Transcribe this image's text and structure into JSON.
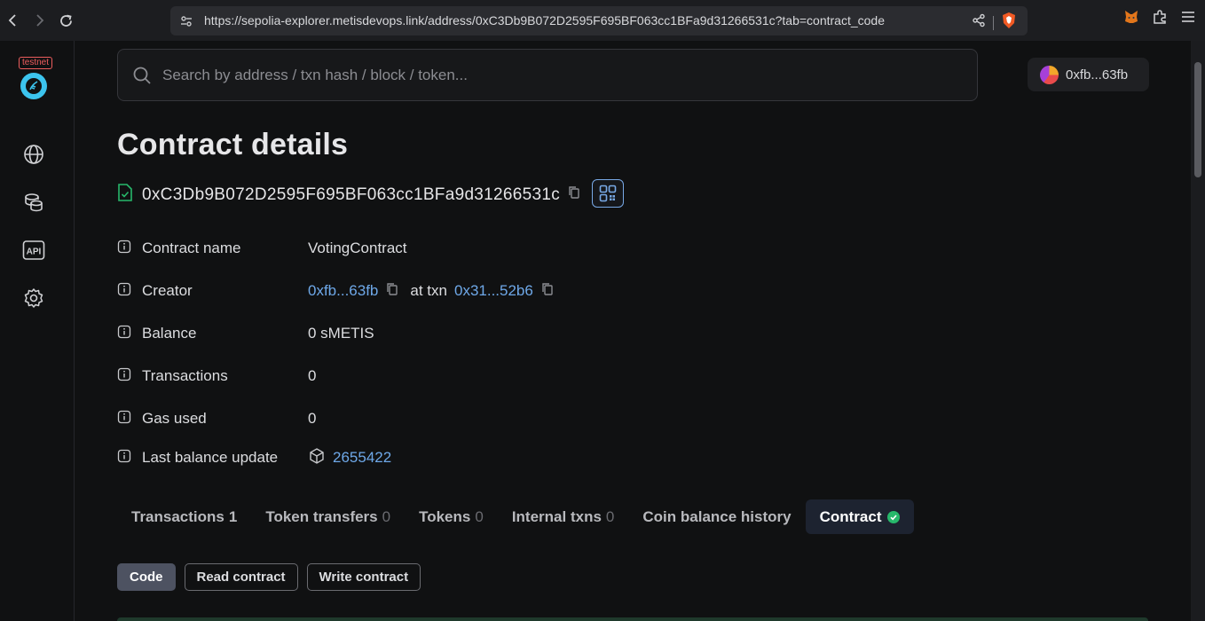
{
  "browser": {
    "url": "https://sepolia-explorer.metisdevops.link/address/0xC3Db9B072D2595F695BF063cc1BFa9d31266531c?tab=contract_code"
  },
  "sidebar": {
    "badge": "testnet",
    "items": [
      {
        "icon": "globe-icon"
      },
      {
        "icon": "coins-icon"
      },
      {
        "icon": "api-icon",
        "label": "API"
      },
      {
        "icon": "gear-icon"
      }
    ]
  },
  "search": {
    "placeholder": "Search by address / txn hash / block / token..."
  },
  "account": {
    "label": "0xfb...63fb"
  },
  "page": {
    "title": "Contract details",
    "address": "0xC3Db9B072D2595F695BF063cc1BFa9d31266531c"
  },
  "details": {
    "contract_name_label": "Contract name",
    "contract_name": "VotingContract",
    "creator_label": "Creator",
    "creator": "0xfb...63fb",
    "at_txn": "at txn",
    "creator_txn": "0x31...52b6",
    "balance_label": "Balance",
    "balance": "0 sMETIS",
    "transactions_label": "Transactions",
    "transactions": "0",
    "gas_label": "Gas used",
    "gas": "0",
    "last_update_label": "Last balance update",
    "last_update": "2655422"
  },
  "tabs": [
    {
      "label": "Transactions",
      "count": "1"
    },
    {
      "label": "Token transfers",
      "count": "0"
    },
    {
      "label": "Tokens",
      "count": "0"
    },
    {
      "label": "Internal txns",
      "count": "0"
    },
    {
      "label": "Coin balance history",
      "count": ""
    },
    {
      "label": "Contract",
      "count": ""
    }
  ],
  "subtabs": [
    {
      "label": "Code"
    },
    {
      "label": "Read contract"
    },
    {
      "label": "Write contract"
    }
  ],
  "colors": {
    "accent_link": "#6ea8e8",
    "verified_green": "#27b86b",
    "testnet_red": "#ec5d5d",
    "logo_cyan": "#3cc4ee"
  }
}
